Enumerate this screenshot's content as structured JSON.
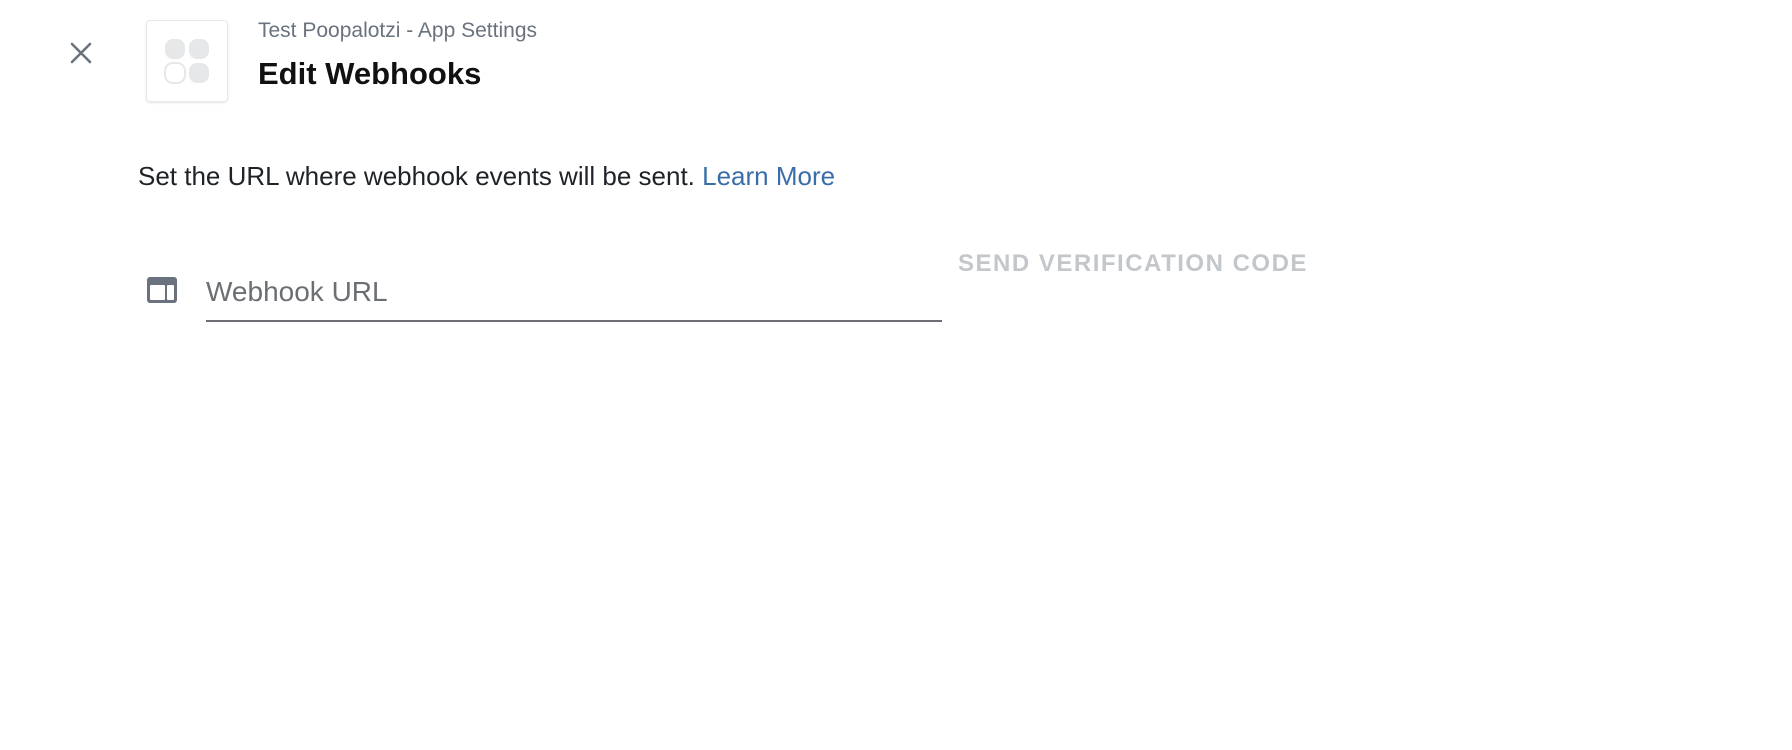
{
  "header": {
    "breadcrumb": "Test Poopalotzi - App Settings",
    "title": "Edit Webhooks",
    "close_icon": "close-icon",
    "app_icon": "app-placeholder-icon"
  },
  "content": {
    "description": "Set the URL where webhook events will be sent.",
    "learn_more_label": "Learn More"
  },
  "webhook_field": {
    "icon": "browser-window-icon",
    "placeholder": "Webhook URL",
    "value": ""
  },
  "actions": {
    "send_verification_label": "SEND VERIFICATION CODE",
    "send_verification_enabled": false
  },
  "colors": {
    "link": "#3a6ea8",
    "disabled_text": "#c3c7cb",
    "icon_gray": "#6a737d"
  }
}
